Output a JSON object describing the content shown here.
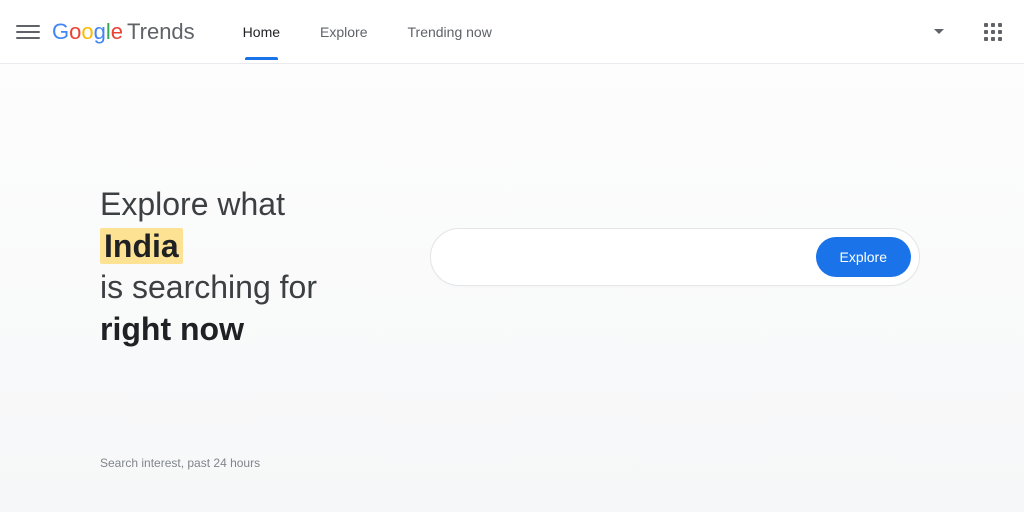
{
  "header": {
    "brand_google": "Google",
    "brand_trends": "Trends",
    "nav": {
      "home": "Home",
      "explore": "Explore",
      "trending_now": "Trending now"
    }
  },
  "hero": {
    "headline": {
      "line1": "Explore what",
      "line2_highlight": "India",
      "line3": "is searching for",
      "line4": "right now"
    },
    "search_placeholder": "",
    "explore_button": "Explore",
    "subtext": "Search interest, past 24 hours"
  }
}
